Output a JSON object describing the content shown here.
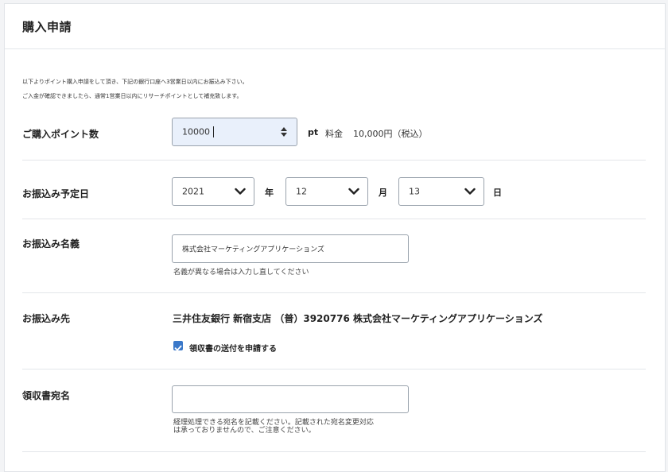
{
  "page": {
    "title": "購入申請",
    "intro_line1": "以下よりポイント購入申請をして頂き、下記の銀行口座へ3営業日以内にお振込み下さい。",
    "intro_line2": "ご入金が確認できましたら、通常1営業日以内にリサーチポイントとして補充致します。"
  },
  "points": {
    "label": "ご購入ポイント数",
    "value": "10000",
    "unit": "pt",
    "fee_label": "料金",
    "fee_value": "10,000円（税込）"
  },
  "date": {
    "label": "お振込み予定日",
    "year": "2021",
    "year_unit": "年",
    "month": "12",
    "month_unit": "月",
    "day": "13",
    "day_unit": "日"
  },
  "name": {
    "label": "お振込み名義",
    "value": "株式会社マーケティングアプリケーションズ",
    "help": "名義が異なる場合は入力し直してください"
  },
  "bank": {
    "label": "お振込み先",
    "details": "三井住友銀行 新宿支店 （普）3920776 株式会社マーケティングアプリケーションズ",
    "receipt_checkbox_label": "領収書の送付を申請する",
    "receipt_checked": true
  },
  "receipt": {
    "label": "領収書宛名",
    "value": "",
    "help_line1": "経理処理できる宛名を記載ください。記載された宛名変更対応",
    "help_line2": "は承っておりませんので、ご注意ください。"
  },
  "colors": {
    "accent": "#3a78c9",
    "field_focus_bg": "#e9f0fb",
    "divider": "#e3e6ea"
  }
}
